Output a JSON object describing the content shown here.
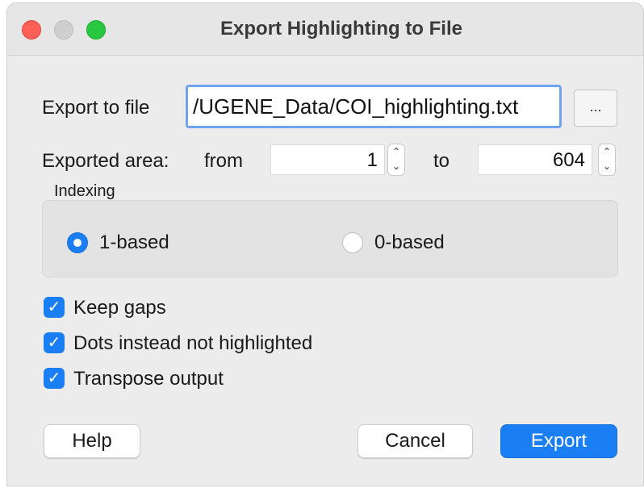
{
  "window": {
    "title": "Export Highlighting to File"
  },
  "export_file": {
    "label": "Export to file",
    "value": "/UGENE_Data/COI_highlighting.txt",
    "browse_label": "..."
  },
  "exported_area": {
    "label": "Exported area:",
    "from_label": "from",
    "from_value": "1",
    "to_label": "to",
    "to_value": "604"
  },
  "indexing": {
    "label": "Indexing",
    "options": [
      {
        "label": "1-based",
        "selected": true
      },
      {
        "label": "0-based",
        "selected": false
      }
    ]
  },
  "options": [
    {
      "label": "Keep gaps",
      "checked": true
    },
    {
      "label": "Dots instead not highlighted",
      "checked": true
    },
    {
      "label": "Transpose output",
      "checked": true
    }
  ],
  "buttons": {
    "help": "Help",
    "cancel": "Cancel",
    "export": "Export"
  },
  "colors": {
    "accent": "#1a7ef5",
    "close": "#fe5f57",
    "minimize": "#cfcfcf",
    "maximize": "#28c840"
  }
}
